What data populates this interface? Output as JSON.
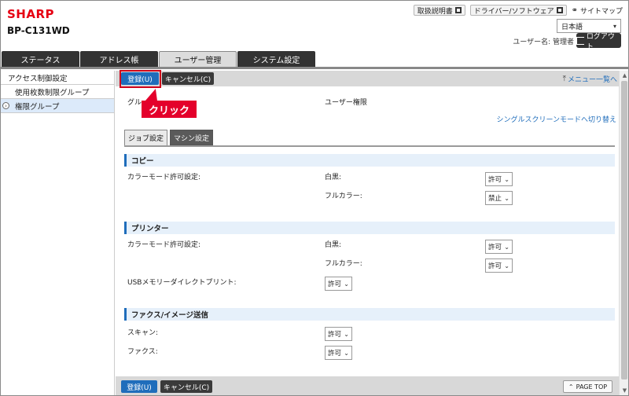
{
  "header": {
    "logo": "SHARP",
    "model": "BP-C131WD",
    "manual_label": "取扱説明書",
    "driver_label": "ドライバー/ソフトウェア",
    "sitemap_label": "サイトマップ",
    "language": "日本語",
    "username_label": "ユーザー名: 管理者",
    "logout_label": "ログアウト"
  },
  "tabs": [
    {
      "label": "ステータス"
    },
    {
      "label": "アドレス帳"
    },
    {
      "label": "ユーザー管理"
    },
    {
      "label": "システム設定"
    }
  ],
  "sidebar": {
    "items": [
      {
        "label": "アクセス制御設定"
      },
      {
        "label": "使用枚数制限グループ"
      },
      {
        "label": "権限グループ"
      }
    ]
  },
  "toolbar": {
    "register_label": "登録(U)",
    "cancel_label": "キャンセル(C)",
    "menu_list_label": "メニュー一覧へ"
  },
  "callout": "クリック",
  "form": {
    "group_label": "グル",
    "user_rights_label": "ユーザー権限",
    "single_screen_link": "シングルスクリーンモードへ切り替え"
  },
  "subtabs": [
    {
      "label": "ジョブ設定"
    },
    {
      "label": "マシン設定"
    }
  ],
  "sections": {
    "copy": {
      "title": "コピー",
      "color_mode_label": "カラーモード許可設定:",
      "mono_label": "白黒:",
      "mono_value": "許可",
      "fullcolor_label": "フルカラー:",
      "fullcolor_value": "禁止"
    },
    "printer": {
      "title": "プリンター",
      "color_mode_label": "カラーモード許可設定:",
      "mono_label": "白黒:",
      "mono_value": "許可",
      "fullcolor_label": "フルカラー:",
      "fullcolor_value": "許可",
      "usb_label": "USBメモリーダイレクトプリント:",
      "usb_value": "許可"
    },
    "fax": {
      "title": "ファクス/イメージ送信",
      "scan_label": "スキャン:",
      "scan_value": "許可",
      "fax_label": "ファクス:",
      "fax_value": "許可"
    }
  },
  "footer": {
    "register_label": "登録(U)",
    "cancel_label": "キャンセル(C)",
    "pagetop_label": "PAGE TOP"
  },
  "colors": {
    "brand": "#e60012",
    "primary_button": "#1f6dbb",
    "callout": "#e4002b"
  }
}
